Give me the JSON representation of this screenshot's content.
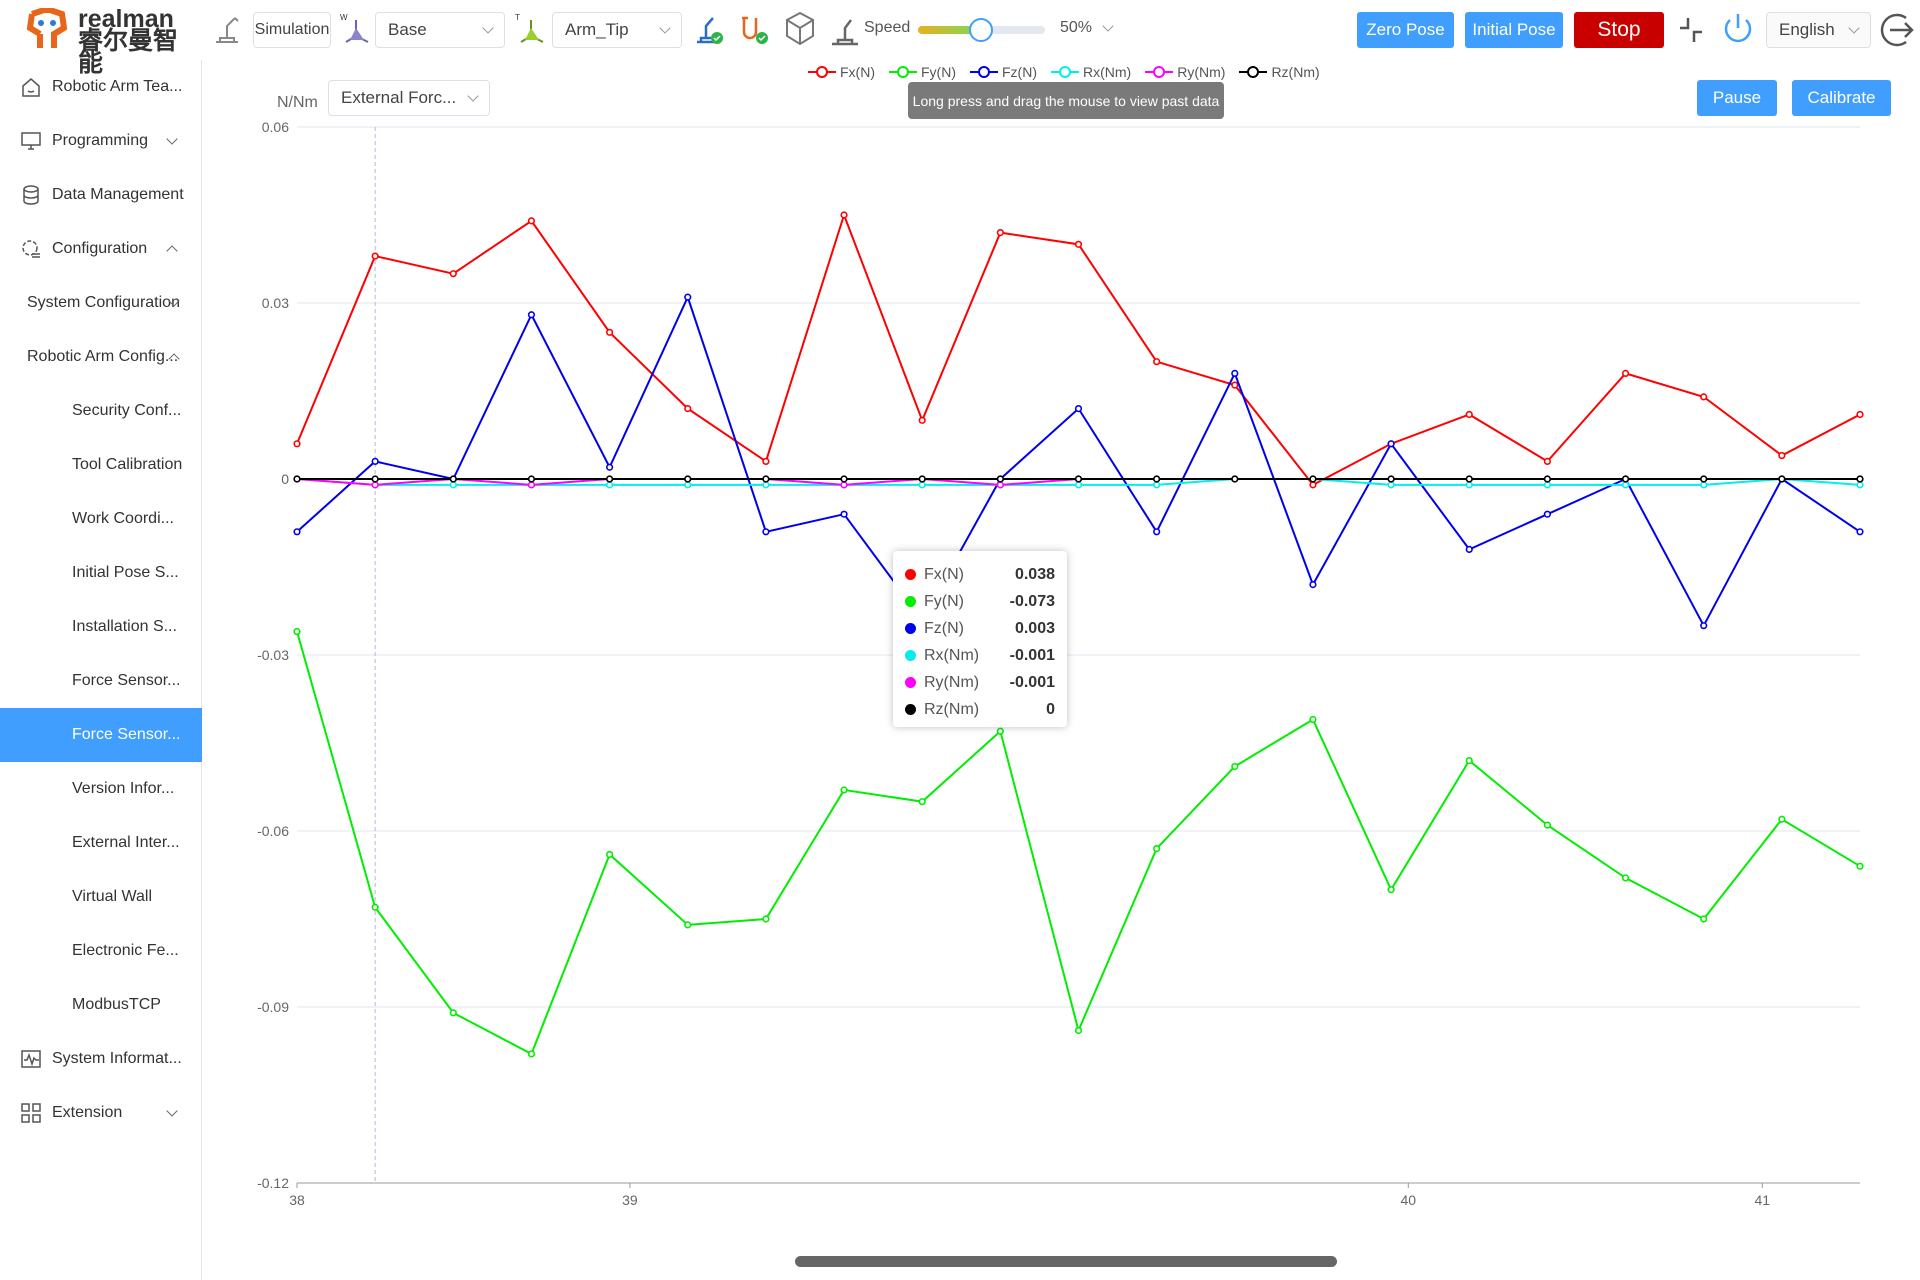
{
  "header": {
    "brand": "realman 睿尔曼智能",
    "mode_button": "Simulation",
    "frame_select": "Base",
    "tool_select": "Arm_Tip",
    "speed_label": "Speed",
    "speed_value": "50%",
    "speed_percent": 50,
    "zero_pose": "Zero Pose",
    "initial_pose": "Initial Pose",
    "stop": "Stop",
    "language": "English",
    "colors": {
      "accent": "#409eff",
      "stop": "#c80000"
    }
  },
  "sidebar": {
    "items": [
      {
        "label": "Robotic Arm Tea...",
        "icon": "home-icon",
        "level": 0
      },
      {
        "label": "Programming",
        "icon": "code-monitor-icon",
        "level": 0,
        "chevron": "down"
      },
      {
        "label": "Data Management",
        "icon": "database-icon",
        "level": 0
      },
      {
        "label": "Configuration",
        "icon": "gear-list-icon",
        "level": 0,
        "chevron": "up"
      },
      {
        "label": "System Configuration",
        "level": 1,
        "chevron": "down"
      },
      {
        "label": "Robotic Arm Config...",
        "level": 1,
        "chevron": "up"
      },
      {
        "label": "Security Conf...",
        "level": 2
      },
      {
        "label": "Tool Calibration",
        "level": 2
      },
      {
        "label": "Work Coordi...",
        "level": 2
      },
      {
        "label": "Initial Pose S...",
        "level": 2
      },
      {
        "label": "Installation S...",
        "level": 2
      },
      {
        "label": "Force Sensor...",
        "level": 2
      },
      {
        "label": "Force Sensor...",
        "level": 2,
        "active": true
      },
      {
        "label": "Version Infor...",
        "level": 2
      },
      {
        "label": "External Inter...",
        "level": 2
      },
      {
        "label": "Virtual Wall",
        "level": 2
      },
      {
        "label": "Electronic Fe...",
        "level": 2
      },
      {
        "label": "ModbusTCP",
        "level": 2
      },
      {
        "label": "System Informat...",
        "icon": "waveform-icon",
        "level": 0
      },
      {
        "label": "Extension",
        "icon": "grid-icon",
        "level": 0,
        "chevron": "down"
      }
    ]
  },
  "main": {
    "unit_label": "N/Nm",
    "data_select": "External Forc...",
    "hint": "Long press and drag the mouse to view past data",
    "pause": "Pause",
    "calibrate": "Calibrate"
  },
  "tooltip": {
    "rows": [
      {
        "name": "Fx(N)",
        "value": "0.038",
        "color": "#ff0000"
      },
      {
        "name": "Fy(N)",
        "value": "-0.073",
        "color": "#00ee00"
      },
      {
        "name": "Fz(N)",
        "value": "0.003",
        "color": "#0000ee"
      },
      {
        "name": "Rx(Nm)",
        "value": "-0.001",
        "color": "#00eeee"
      },
      {
        "name": "Ry(Nm)",
        "value": "-0.001",
        "color": "#ff00ff"
      },
      {
        "name": "Rz(Nm)",
        "value": "0",
        "color": "#000000"
      }
    ]
  },
  "chart_data": {
    "type": "line",
    "ylim": [
      -0.12,
      0.06
    ],
    "yticks": [
      "0.06",
      "0.03",
      "0",
      "-0.03",
      "-0.06",
      "-0.09",
      "-0.12"
    ],
    "xticks": [
      {
        "label": "38",
        "at_index": 0
      },
      {
        "label": "39",
        "at_index": 4.26
      },
      {
        "label": "40",
        "at_index": 14.22
      },
      {
        "label": "41",
        "at_index": 18.75
      }
    ],
    "grid": true,
    "legend": "top-center",
    "highlight_index": 1,
    "series": [
      {
        "name": "Fx(N)",
        "color": "#ff0000",
        "values": [
          0.006,
          0.038,
          0.035,
          0.044,
          0.025,
          0.012,
          0.003,
          0.045,
          0.01,
          0.042,
          0.04,
          0.02,
          0.016,
          -0.001,
          0.006,
          0.011,
          0.003,
          0.018,
          0.014,
          0.004,
          0.011
        ]
      },
      {
        "name": "Fy(N)",
        "color": "#00ee00",
        "values": [
          -0.026,
          -0.073,
          -0.091,
          -0.098,
          -0.064,
          -0.076,
          -0.075,
          -0.053,
          -0.055,
          -0.043,
          -0.094,
          -0.063,
          -0.049,
          -0.041,
          -0.07,
          -0.048,
          -0.059,
          -0.068,
          -0.075,
          -0.058,
          -0.066
        ]
      },
      {
        "name": "Fz(N)",
        "color": "#0000ee",
        "values": [
          -0.009,
          0.003,
          0,
          0.028,
          0.002,
          0.031,
          -0.009,
          -0.006,
          -0.024,
          0,
          0.012,
          -0.009,
          0.018,
          -0.018,
          0.006,
          -0.012,
          -0.006,
          0,
          -0.025,
          0,
          -0.009
        ]
      },
      {
        "name": "Rx(Nm)",
        "color": "#00eeee",
        "values": [
          0,
          -0.001,
          -0.001,
          -0.001,
          -0.001,
          -0.001,
          -0.001,
          -0.001,
          -0.001,
          -0.001,
          -0.001,
          -0.001,
          0,
          0,
          -0.001,
          -0.001,
          -0.001,
          -0.001,
          -0.001,
          0,
          -0.001
        ]
      },
      {
        "name": "Ry(Nm)",
        "color": "#ff00ff",
        "values": [
          0,
          -0.001,
          0,
          -0.001,
          0,
          0,
          0,
          -0.001,
          0,
          -0.001,
          0,
          0,
          0,
          0,
          0,
          0,
          0,
          0,
          0,
          0,
          0
        ]
      },
      {
        "name": "Rz(Nm)",
        "color": "#000000",
        "values": [
          0,
          0,
          0,
          0,
          0,
          0,
          0,
          0,
          0,
          0,
          0,
          0,
          0,
          0,
          0,
          0,
          0,
          0,
          0,
          0,
          0
        ]
      }
    ]
  }
}
